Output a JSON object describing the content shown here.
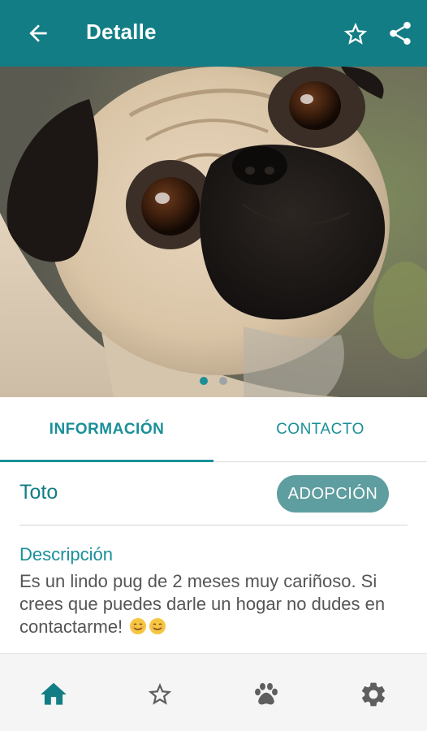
{
  "appbar": {
    "title": "Detalle",
    "color": "#137d85",
    "icons": {
      "back": "arrow-back-icon",
      "favorite": "star-outline-icon",
      "share": "share-icon"
    }
  },
  "gallery": {
    "image": "pug-photo",
    "pages": 2,
    "active_page": 1
  },
  "tabs": [
    {
      "label": "INFORMACIÓN",
      "selected": true
    },
    {
      "label": "CONTACTO",
      "selected": false
    }
  ],
  "pet": {
    "name": "Toto",
    "status": "ADOPCIÓN",
    "description_title": "Descripción",
    "description": "Es un lindo pug de 2 meses muy cariñoso. Si crees que puedes darle un hogar no dudes en contactarme!",
    "description_emoji": "☺☺"
  },
  "bottom_nav": {
    "items": [
      {
        "icon": "home-icon",
        "selected": true
      },
      {
        "icon": "star-outline-icon",
        "selected": false
      },
      {
        "icon": "paw-icon",
        "selected": false
      },
      {
        "icon": "gear-icon",
        "selected": false
      }
    ],
    "active_color": "#137d85",
    "inactive_color": "#5f5f5f"
  }
}
